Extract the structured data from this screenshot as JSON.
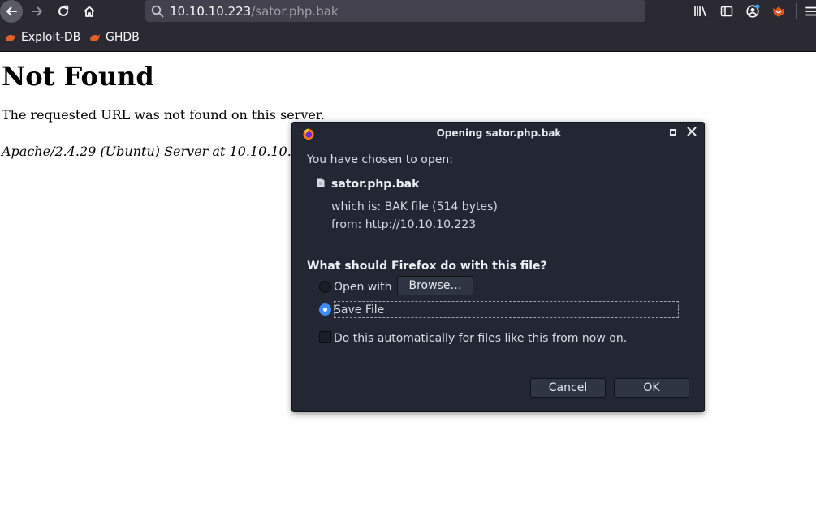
{
  "browser": {
    "url_host": "10.10.10.223",
    "url_path": "/sator.php.bak",
    "bookmarks": [
      {
        "label": "Exploit-DB",
        "icon": "exploit-db-icon"
      },
      {
        "label": "GHDB",
        "icon": "ghdb-icon"
      }
    ],
    "colors": {
      "chrome": "#2b2a33",
      "urlbar": "#42414d"
    }
  },
  "page": {
    "heading": "Not Found",
    "message": "The requested URL was not found on this server.",
    "signature": "Apache/2.4.29 (Ubuntu) Server at 10.10.10."
  },
  "dialog": {
    "title": "Opening sator.php.bak",
    "intro": "You have chosen to open:",
    "filename": "sator.php.bak",
    "which_is_label": "which is:",
    "which_is_value": "BAK file (514 bytes)",
    "from_label": "from:",
    "from_value": "http://10.10.10.223",
    "question": "What should Firefox do with this file?",
    "open_with_label": "Open with",
    "browse_label": "Browse…",
    "save_file_label": "Save File",
    "auto_label": "Do this automatically for files like this from now on.",
    "cancel_label": "Cancel",
    "ok_label": "OK",
    "selected_option": "save_file",
    "auto_checked": false,
    "colors": {
      "background": "#222733",
      "accent": "#3d8bfd"
    }
  }
}
